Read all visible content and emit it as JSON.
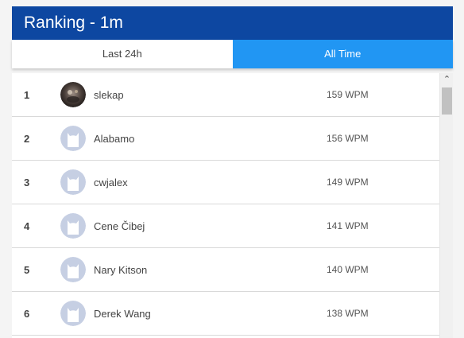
{
  "header": {
    "title": "Ranking - 1m"
  },
  "tabs": [
    {
      "label": "Last 24h",
      "active": false
    },
    {
      "label": "All Time",
      "active": true
    }
  ],
  "rows": [
    {
      "rank": "1",
      "name": "slekap",
      "wpm": "159 WPM",
      "avatar": "photo"
    },
    {
      "rank": "2",
      "name": "Alabamo",
      "wpm": "156 WPM",
      "avatar": "default"
    },
    {
      "rank": "3",
      "name": "cwjalex",
      "wpm": "149 WPM",
      "avatar": "default"
    },
    {
      "rank": "4",
      "name": "Cene Čibej",
      "wpm": "141 WPM",
      "avatar": "default"
    },
    {
      "rank": "5",
      "name": "Nary Kitson",
      "wpm": "140 WPM",
      "avatar": "default"
    },
    {
      "rank": "6",
      "name": "Derek Wang",
      "wpm": "138 WPM",
      "avatar": "default"
    }
  ],
  "colors": {
    "header_bg": "#0d47a1",
    "tab_active_bg": "#2196f3",
    "avatar_default": "#c6cfe3"
  },
  "icons": {
    "scroll_up": "chevron-up-icon",
    "default_avatar": "cat-silhouette-icon"
  }
}
